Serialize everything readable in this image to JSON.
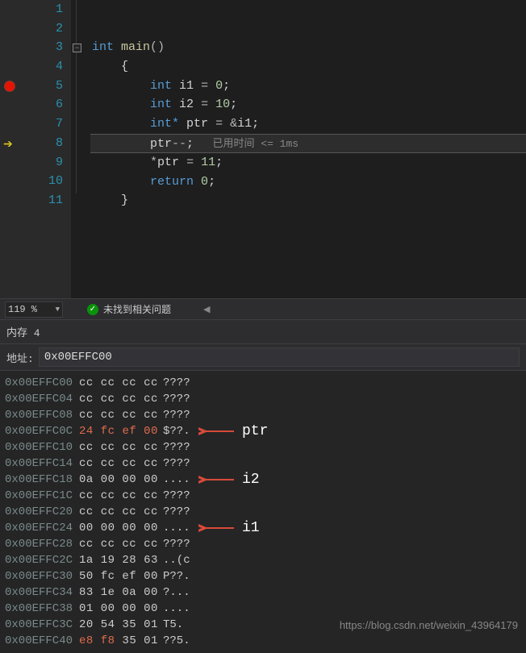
{
  "editor": {
    "lines": [
      {
        "n": 1,
        "indent": "",
        "raw": ""
      },
      {
        "n": 2,
        "indent": "",
        "raw": ""
      },
      {
        "n": 3,
        "indent": "",
        "kw": "int",
        "fn": "main",
        "after": "()"
      },
      {
        "n": 4,
        "indent": "    ",
        "brace": "{"
      },
      {
        "n": 5,
        "indent": "        ",
        "kw": "int",
        "var": "i1",
        "op": "=",
        "num": "0",
        "semi": ";"
      },
      {
        "n": 6,
        "indent": "        ",
        "kw": "int",
        "var": "i2",
        "op": "=",
        "num": "10",
        "semi": ";"
      },
      {
        "n": 7,
        "indent": "        ",
        "kw": "int*",
        "var": "ptr",
        "op": "=",
        "amp": "&",
        "ref": "i1",
        "semi": ";"
      },
      {
        "n": 8,
        "indent": "        ",
        "var": "ptr",
        "op": "--",
        "semi": ";",
        "hint": "   已用时间 <= 1ms"
      },
      {
        "n": 9,
        "indent": "        ",
        "star": "*",
        "var": "ptr",
        "op": "=",
        "num": "11",
        "semi": ";"
      },
      {
        "n": 10,
        "indent": "        ",
        "kw": "return",
        "num": "0",
        "semi": ";"
      },
      {
        "n": 11,
        "indent": "    ",
        "brace": "}"
      }
    ],
    "breakpoint_line": 5,
    "current_line": 8
  },
  "status": {
    "zoom": "119 %",
    "issues_text": "未找到相关问题"
  },
  "memory": {
    "title": "内存 4",
    "address_label": "地址:",
    "address_value": "0x00EFFC00",
    "rows": [
      {
        "addr": "0x00EFFC00",
        "b": [
          "cc",
          "cc",
          "cc",
          "cc"
        ],
        "ascii": "????"
      },
      {
        "addr": "0x00EFFC04",
        "b": [
          "cc",
          "cc",
          "cc",
          "cc"
        ],
        "ascii": "????"
      },
      {
        "addr": "0x00EFFC08",
        "b": [
          "cc",
          "cc",
          "cc",
          "cc"
        ],
        "ascii": "????"
      },
      {
        "addr": "0x00EFFC0C",
        "b": [
          "24",
          "fc",
          "ef",
          "00"
        ],
        "ascii": "$??.",
        "hot": [
          0,
          1,
          2,
          3
        ],
        "label": "ptr"
      },
      {
        "addr": "0x00EFFC10",
        "b": [
          "cc",
          "cc",
          "cc",
          "cc"
        ],
        "ascii": "????"
      },
      {
        "addr": "0x00EFFC14",
        "b": [
          "cc",
          "cc",
          "cc",
          "cc"
        ],
        "ascii": "????"
      },
      {
        "addr": "0x00EFFC18",
        "b": [
          "0a",
          "00",
          "00",
          "00"
        ],
        "ascii": "....",
        "label": "i2"
      },
      {
        "addr": "0x00EFFC1C",
        "b": [
          "cc",
          "cc",
          "cc",
          "cc"
        ],
        "ascii": "????"
      },
      {
        "addr": "0x00EFFC20",
        "b": [
          "cc",
          "cc",
          "cc",
          "cc"
        ],
        "ascii": "????"
      },
      {
        "addr": "0x00EFFC24",
        "b": [
          "00",
          "00",
          "00",
          "00"
        ],
        "ascii": "....",
        "label": "i1"
      },
      {
        "addr": "0x00EFFC28",
        "b": [
          "cc",
          "cc",
          "cc",
          "cc"
        ],
        "ascii": "????"
      },
      {
        "addr": "0x00EFFC2C",
        "b": [
          "1a",
          "19",
          "28",
          "63"
        ],
        "ascii": "..(c"
      },
      {
        "addr": "0x00EFFC30",
        "b": [
          "50",
          "fc",
          "ef",
          "00"
        ],
        "ascii": "P??."
      },
      {
        "addr": "0x00EFFC34",
        "b": [
          "83",
          "1e",
          "0a",
          "00"
        ],
        "ascii": "?..."
      },
      {
        "addr": "0x00EFFC38",
        "b": [
          "01",
          "00",
          "00",
          "00"
        ],
        "ascii": "...."
      },
      {
        "addr": "0x00EFFC3C",
        "b": [
          "20",
          "54",
          "35",
          "01"
        ],
        "ascii": " T5."
      },
      {
        "addr": "0x00EFFC40",
        "b": [
          "e8",
          "f8",
          "35",
          "01"
        ],
        "ascii": "??5.",
        "hot": [
          0,
          1
        ]
      }
    ]
  },
  "watermark": "https://blog.csdn.net/weixin_43964179"
}
